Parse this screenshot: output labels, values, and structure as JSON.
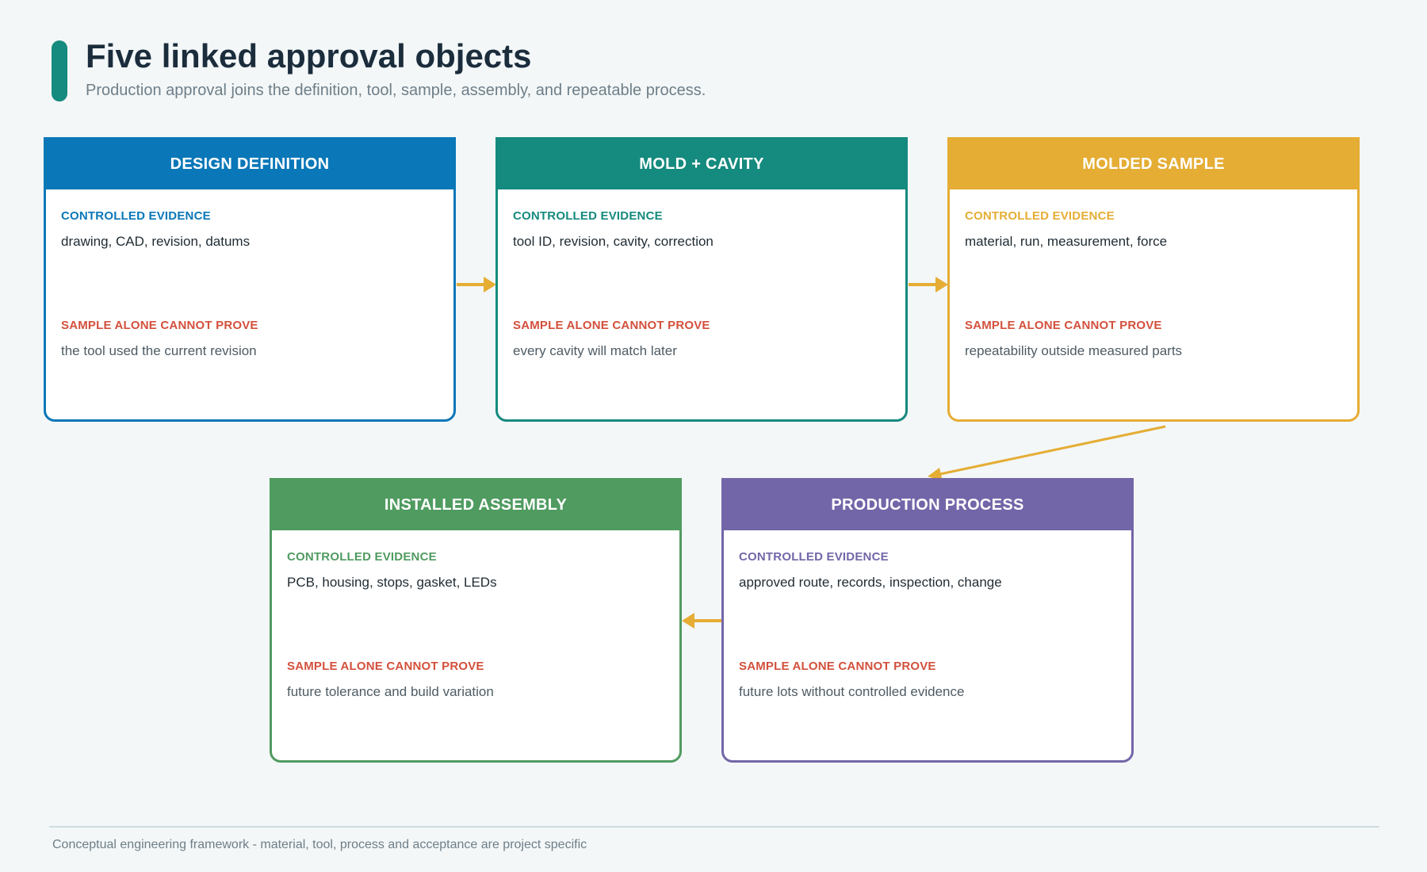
{
  "header": {
    "title": "Five linked approval objects",
    "subtitle": "Production approval joins the definition, tool, sample, assembly, and repeatable process."
  },
  "colors": {
    "accent": "#158a7e",
    "arrow": "#e5ad34",
    "warning_label": "#d3503c"
  },
  "cards": [
    {
      "title": "DESIGN DEFINITION",
      "color": "#0a77b8",
      "evidence_label": "CONTROLLED EVIDENCE",
      "evidence": "drawing, CAD, revision, datums",
      "not_proven_label": "SAMPLE ALONE CANNOT PROVE",
      "not_proven": "the tool used the current revision"
    },
    {
      "title": "MOLD + CAVITY",
      "color": "#158a7e",
      "evidence_label": "CONTROLLED EVIDENCE",
      "evidence": "tool ID, revision, cavity, correction",
      "not_proven_label": "SAMPLE ALONE CANNOT PROVE",
      "not_proven": "every cavity will match later"
    },
    {
      "title": "MOLDED SAMPLE",
      "color": "#e5ad34",
      "evidence_label": "CONTROLLED EVIDENCE",
      "evidence": "material, run, measurement, force",
      "not_proven_label": "SAMPLE ALONE CANNOT PROVE",
      "not_proven": "repeatability outside measured parts"
    },
    {
      "title": "INSTALLED ASSEMBLY",
      "color": "#4f9b60",
      "evidence_label": "CONTROLLED EVIDENCE",
      "evidence": "PCB, housing, stops, gasket, LEDs",
      "not_proven_label": "SAMPLE ALONE CANNOT PROVE",
      "not_proven": "future tolerance and build variation"
    },
    {
      "title": "PRODUCTION PROCESS",
      "color": "#7366a8",
      "evidence_label": "CONTROLLED EVIDENCE",
      "evidence": "approved route, records, inspection, change",
      "not_proven_label": "SAMPLE ALONE CANNOT PROVE",
      "not_proven": "future lots without controlled evidence"
    }
  ],
  "footer": {
    "note": "Conceptual engineering framework - material, tool, process and acceptance are project specific"
  }
}
